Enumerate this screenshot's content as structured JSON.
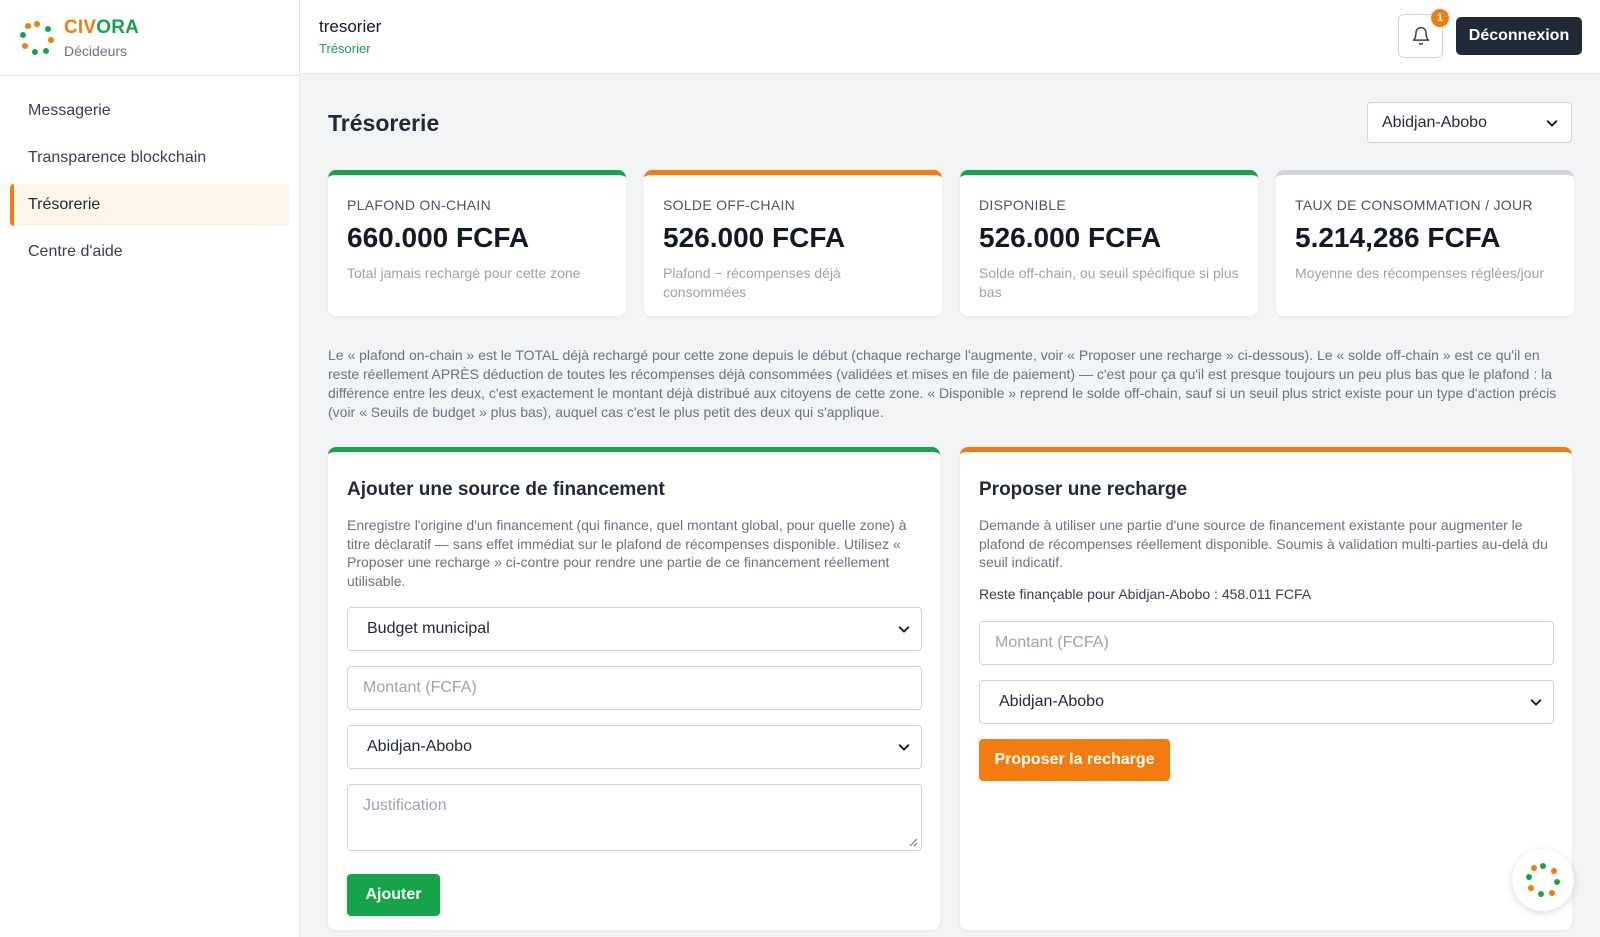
{
  "brand": {
    "name_part1": "CIV",
    "name_part2": "ORA",
    "subtitle": "Décideurs"
  },
  "sidebar": {
    "items": [
      {
        "label": "Messagerie",
        "active": false
      },
      {
        "label": "Transparence blockchain",
        "active": false
      },
      {
        "label": "Trésorerie",
        "active": true
      },
      {
        "label": "Centre d'aide",
        "active": false
      }
    ]
  },
  "header": {
    "user_name": "tresorier",
    "user_role": "Trésorier",
    "notification_count": "1",
    "logout_label": "Déconnexion"
  },
  "page": {
    "title": "Trésorerie",
    "zone_select": "Abidjan-Abobo"
  },
  "kpis": [
    {
      "label": "PLAFOND ON-CHAIN",
      "value": "660.000 FCFA",
      "desc": "Total jamais rechargé pour cette zone",
      "color": "#16a34a"
    },
    {
      "label": "SOLDE OFF-CHAIN",
      "value": "526.000 FCFA",
      "desc": "Plafond − récompenses déjà consommées",
      "color": "#f47c0e"
    },
    {
      "label": "DISPONIBLE",
      "value": "526.000 FCFA",
      "desc": "Solde off-chain, ou seuil spécifique si plus bas",
      "color": "#16a34a"
    },
    {
      "label": "TAUX DE CONSOMMATION / JOUR",
      "value": "5.214,286 FCFA",
      "desc": "Moyenne des récompenses réglées/jour",
      "color": "#d1d5db"
    }
  ],
  "explanation": "Le « plafond on-chain » est le TOTAL déjà rechargé pour cette zone depuis le début (chaque recharge l'augmente, voir « Proposer une recharge » ci-dessous). Le « solde off-chain » est ce qu'il en reste réellement APRÈS déduction de toutes les récompenses déjà consommées (validées et mises en file de paiement) — c'est pour ça qu'il est presque toujours un peu plus bas que le plafond : la différence entre les deux, c'est exactement le montant déjà distribué aux citoyens de cette zone. « Disponible » reprend le solde off-chain, sauf si un seuil plus strict existe pour un type d'action précis (voir « Seuils de budget » plus bas), auquel cas c'est le plus petit des deux qui s'applique.",
  "funding_form": {
    "title": "Ajouter une source de financement",
    "description": "Enregistre l'origine d'un financement (qui finance, quel montant global, pour quelle zone) à titre déclaratif — sans effet immédiat sur le plafond de récompenses disponible. Utilisez « Proposer une recharge » ci-contre pour rendre une partie de ce financement réellement utilisable.",
    "source_select": "Budget municipal",
    "amount_placeholder": "Montant (FCFA)",
    "zone_select": "Abidjan-Abobo",
    "justification_placeholder": "Justification",
    "submit_label": "Ajouter",
    "accent": "#16a34a"
  },
  "recharge_form": {
    "title": "Proposer une recharge",
    "description": "Demande à utiliser une partie d'une source de financement existante pour augmenter le plafond de récompenses réellement disponible. Soumis à validation multi-parties au-delà du seuil indicatif.",
    "remaining": "Reste finançable pour Abidjan-Abobo : 458.011 FCFA",
    "amount_placeholder": "Montant (FCFA)",
    "zone_select": "Abidjan-Abobo",
    "submit_label": "Proposer la recharge",
    "accent": "#f47c0e"
  },
  "icons": [
    "logo-icon",
    "bell-icon",
    "chevron-down-icon",
    "resize-grip-icon",
    "assistant-logo-icon"
  ]
}
